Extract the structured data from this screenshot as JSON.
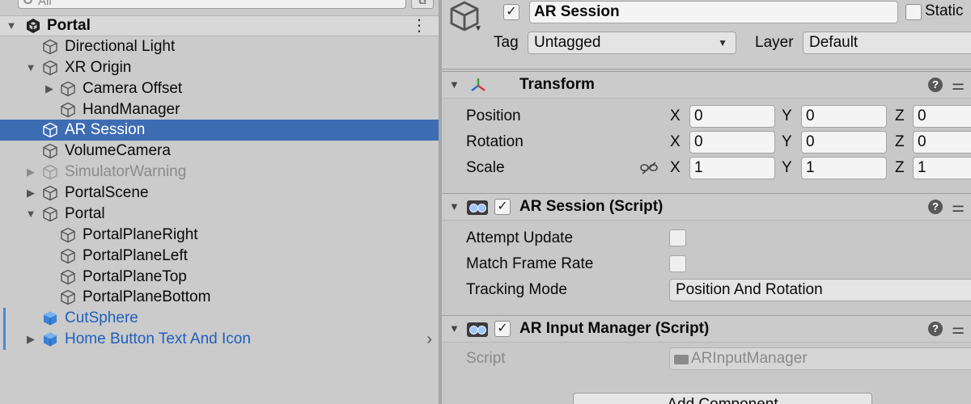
{
  "hierarchy": {
    "search": {
      "placeholder": "All"
    },
    "scene": {
      "name": "Portal"
    },
    "items": [
      {
        "label": "Directional Light"
      },
      {
        "label": "XR Origin"
      },
      {
        "label": "Camera Offset"
      },
      {
        "label": "HandManager"
      },
      {
        "label": "AR Session"
      },
      {
        "label": "VolumeCamera"
      },
      {
        "label": "SimulatorWarning"
      },
      {
        "label": "PortalScene"
      },
      {
        "label": "Portal"
      },
      {
        "label": "PortalPlaneRight"
      },
      {
        "label": "PortalPlaneLeft"
      },
      {
        "label": "PortalPlaneTop"
      },
      {
        "label": "PortalPlaneBottom"
      },
      {
        "label": "CutSphere"
      },
      {
        "label": "Home Button Text And Icon"
      }
    ]
  },
  "inspector": {
    "object_name": "AR Session",
    "static_label": "Static",
    "tag_label": "Tag",
    "tag_value": "Untagged",
    "layer_label": "Layer",
    "layer_value": "Default",
    "transform": {
      "title": "Transform",
      "position_label": "Position",
      "rotation_label": "Rotation",
      "scale_label": "Scale",
      "position": {
        "x": "0",
        "y": "0",
        "z": "0"
      },
      "rotation": {
        "x": "0",
        "y": "0",
        "z": "0"
      },
      "scale": {
        "x": "1",
        "y": "1",
        "z": "1"
      },
      "axis_x": "X",
      "axis_y": "Y",
      "axis_z": "Z"
    },
    "ar_session": {
      "title": "AR Session (Script)",
      "attempt_update_label": "Attempt Update",
      "match_frame_rate_label": "Match Frame Rate",
      "tracking_mode_label": "Tracking Mode",
      "tracking_mode_value": "Position And Rotation"
    },
    "ar_input_manager": {
      "title": "AR Input Manager (Script)",
      "script_label": "Script",
      "script_value": "ARInputManager"
    },
    "add_component_label": "Add Component"
  },
  "colors": {
    "selection": "#3d6cb3",
    "prefab_text": "#1f5fbf",
    "panel_bg": "#c8c8c8"
  }
}
